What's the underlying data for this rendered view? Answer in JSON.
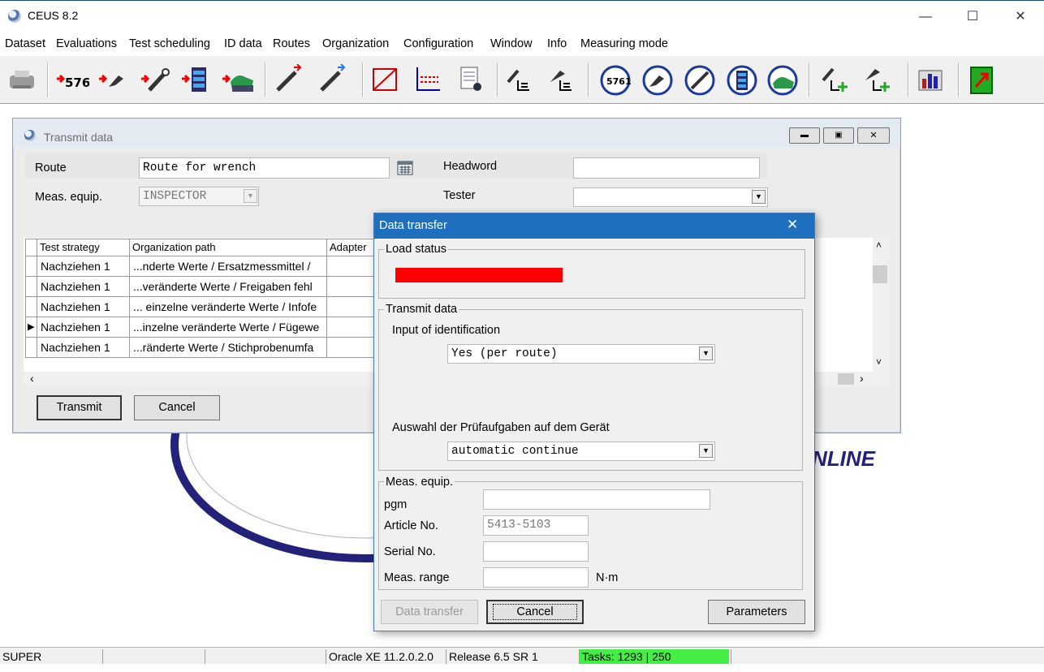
{
  "app": {
    "title": "CEUS 8.2"
  },
  "menu": [
    "Dataset",
    "Evaluations",
    "Test scheduling",
    "ID data",
    "Routes",
    "Organization",
    "Configuration",
    "Window",
    "Info",
    "Measuring mode"
  ],
  "toolbar": {
    "badge_a": "5761",
    "badge_b": "5761"
  },
  "background": {
    "logo_text": "NLINE"
  },
  "child_window": {
    "title": "Transmit data",
    "route_label": "Route",
    "route_value": "Route for wrench",
    "meas_equip_label": "Meas. equip.",
    "meas_equip_value": "INSPECTOR",
    "headword_label": "Headword",
    "headword_value": "",
    "tester_label": "Tester",
    "tester_value": "",
    "table": {
      "columns": [
        "Test strategy",
        "Organization path",
        "Adapter"
      ],
      "rows": [
        {
          "strategy": "Nachziehen 1",
          "path": "...nderte Werte / Ersatzmessmittel /",
          "adapter": "",
          "current": false
        },
        {
          "strategy": "Nachziehen 1",
          "path": "...veränderte Werte / Freigaben fehl",
          "adapter": "",
          "current": false
        },
        {
          "strategy": "Nachziehen 1",
          "path": "... einzelne veränderte Werte / Infofe",
          "adapter": "",
          "current": false
        },
        {
          "strategy": "Nachziehen 1",
          "path": "...inzelne veränderte Werte / Fügewe",
          "adapter": "",
          "current": true
        },
        {
          "strategy": "Nachziehen 1",
          "path": "...ränderte Werte / Stichprobenumfa",
          "adapter": "",
          "current": false
        }
      ]
    },
    "transmit_button": "Transmit",
    "cancel_button": "Cancel"
  },
  "dialog": {
    "title": "Data transfer",
    "load_status_label": "Load status",
    "load_status_color": "#ff0000",
    "transmit_group_label": "Transmit data",
    "input_identification_label": "Input of identification",
    "input_identification_value": "Yes (per route)",
    "auswahl_label": "Auswahl der Prüfaufgaben auf dem Gerät",
    "auswahl_value": "automatic continue",
    "meas_group_label": "Meas. equip.",
    "pgm_label": "pgm",
    "pgm_value": "",
    "article_label": "Article No.",
    "article_value": "5413-5103",
    "serial_label": "Serial No.",
    "serial_value": "",
    "range_label": "Meas. range",
    "range_value": "",
    "range_unit": "N·m",
    "data_transfer_button": "Data transfer",
    "cancel_button": "Cancel",
    "parameters_button": "Parameters"
  },
  "statusbar": {
    "user": "SUPER",
    "slot2": "",
    "slot3": "",
    "db": "Oracle XE 11.2.0.2.0",
    "release": "Release 6.5 SR 1",
    "tasks": "Tasks: 1293 | 250",
    "tasks_color": "#44ee44"
  }
}
